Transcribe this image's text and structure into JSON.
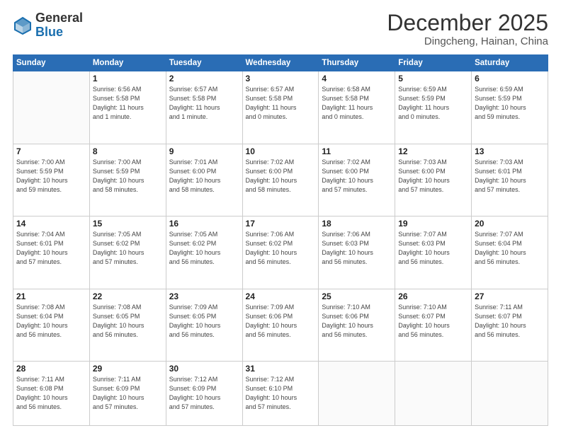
{
  "header": {
    "logo_line1": "General",
    "logo_line2": "Blue",
    "month_title": "December 2025",
    "location": "Dingcheng, Hainan, China"
  },
  "weekdays": [
    "Sunday",
    "Monday",
    "Tuesday",
    "Wednesday",
    "Thursday",
    "Friday",
    "Saturday"
  ],
  "weeks": [
    [
      {
        "day": "",
        "info": ""
      },
      {
        "day": "1",
        "info": "Sunrise: 6:56 AM\nSunset: 5:58 PM\nDaylight: 11 hours\nand 1 minute."
      },
      {
        "day": "2",
        "info": "Sunrise: 6:57 AM\nSunset: 5:58 PM\nDaylight: 11 hours\nand 1 minute."
      },
      {
        "day": "3",
        "info": "Sunrise: 6:57 AM\nSunset: 5:58 PM\nDaylight: 11 hours\nand 0 minutes."
      },
      {
        "day": "4",
        "info": "Sunrise: 6:58 AM\nSunset: 5:58 PM\nDaylight: 11 hours\nand 0 minutes."
      },
      {
        "day": "5",
        "info": "Sunrise: 6:59 AM\nSunset: 5:59 PM\nDaylight: 11 hours\nand 0 minutes."
      },
      {
        "day": "6",
        "info": "Sunrise: 6:59 AM\nSunset: 5:59 PM\nDaylight: 10 hours\nand 59 minutes."
      }
    ],
    [
      {
        "day": "7",
        "info": "Sunrise: 7:00 AM\nSunset: 5:59 PM\nDaylight: 10 hours\nand 59 minutes."
      },
      {
        "day": "8",
        "info": "Sunrise: 7:00 AM\nSunset: 5:59 PM\nDaylight: 10 hours\nand 58 minutes."
      },
      {
        "day": "9",
        "info": "Sunrise: 7:01 AM\nSunset: 6:00 PM\nDaylight: 10 hours\nand 58 minutes."
      },
      {
        "day": "10",
        "info": "Sunrise: 7:02 AM\nSunset: 6:00 PM\nDaylight: 10 hours\nand 58 minutes."
      },
      {
        "day": "11",
        "info": "Sunrise: 7:02 AM\nSunset: 6:00 PM\nDaylight: 10 hours\nand 57 minutes."
      },
      {
        "day": "12",
        "info": "Sunrise: 7:03 AM\nSunset: 6:00 PM\nDaylight: 10 hours\nand 57 minutes."
      },
      {
        "day": "13",
        "info": "Sunrise: 7:03 AM\nSunset: 6:01 PM\nDaylight: 10 hours\nand 57 minutes."
      }
    ],
    [
      {
        "day": "14",
        "info": "Sunrise: 7:04 AM\nSunset: 6:01 PM\nDaylight: 10 hours\nand 57 minutes."
      },
      {
        "day": "15",
        "info": "Sunrise: 7:05 AM\nSunset: 6:02 PM\nDaylight: 10 hours\nand 57 minutes."
      },
      {
        "day": "16",
        "info": "Sunrise: 7:05 AM\nSunset: 6:02 PM\nDaylight: 10 hours\nand 56 minutes."
      },
      {
        "day": "17",
        "info": "Sunrise: 7:06 AM\nSunset: 6:02 PM\nDaylight: 10 hours\nand 56 minutes."
      },
      {
        "day": "18",
        "info": "Sunrise: 7:06 AM\nSunset: 6:03 PM\nDaylight: 10 hours\nand 56 minutes."
      },
      {
        "day": "19",
        "info": "Sunrise: 7:07 AM\nSunset: 6:03 PM\nDaylight: 10 hours\nand 56 minutes."
      },
      {
        "day": "20",
        "info": "Sunrise: 7:07 AM\nSunset: 6:04 PM\nDaylight: 10 hours\nand 56 minutes."
      }
    ],
    [
      {
        "day": "21",
        "info": "Sunrise: 7:08 AM\nSunset: 6:04 PM\nDaylight: 10 hours\nand 56 minutes."
      },
      {
        "day": "22",
        "info": "Sunrise: 7:08 AM\nSunset: 6:05 PM\nDaylight: 10 hours\nand 56 minutes."
      },
      {
        "day": "23",
        "info": "Sunrise: 7:09 AM\nSunset: 6:05 PM\nDaylight: 10 hours\nand 56 minutes."
      },
      {
        "day": "24",
        "info": "Sunrise: 7:09 AM\nSunset: 6:06 PM\nDaylight: 10 hours\nand 56 minutes."
      },
      {
        "day": "25",
        "info": "Sunrise: 7:10 AM\nSunset: 6:06 PM\nDaylight: 10 hours\nand 56 minutes."
      },
      {
        "day": "26",
        "info": "Sunrise: 7:10 AM\nSunset: 6:07 PM\nDaylight: 10 hours\nand 56 minutes."
      },
      {
        "day": "27",
        "info": "Sunrise: 7:11 AM\nSunset: 6:07 PM\nDaylight: 10 hours\nand 56 minutes."
      }
    ],
    [
      {
        "day": "28",
        "info": "Sunrise: 7:11 AM\nSunset: 6:08 PM\nDaylight: 10 hours\nand 56 minutes."
      },
      {
        "day": "29",
        "info": "Sunrise: 7:11 AM\nSunset: 6:09 PM\nDaylight: 10 hours\nand 57 minutes."
      },
      {
        "day": "30",
        "info": "Sunrise: 7:12 AM\nSunset: 6:09 PM\nDaylight: 10 hours\nand 57 minutes."
      },
      {
        "day": "31",
        "info": "Sunrise: 7:12 AM\nSunset: 6:10 PM\nDaylight: 10 hours\nand 57 minutes."
      },
      {
        "day": "",
        "info": ""
      },
      {
        "day": "",
        "info": ""
      },
      {
        "day": "",
        "info": ""
      }
    ]
  ]
}
